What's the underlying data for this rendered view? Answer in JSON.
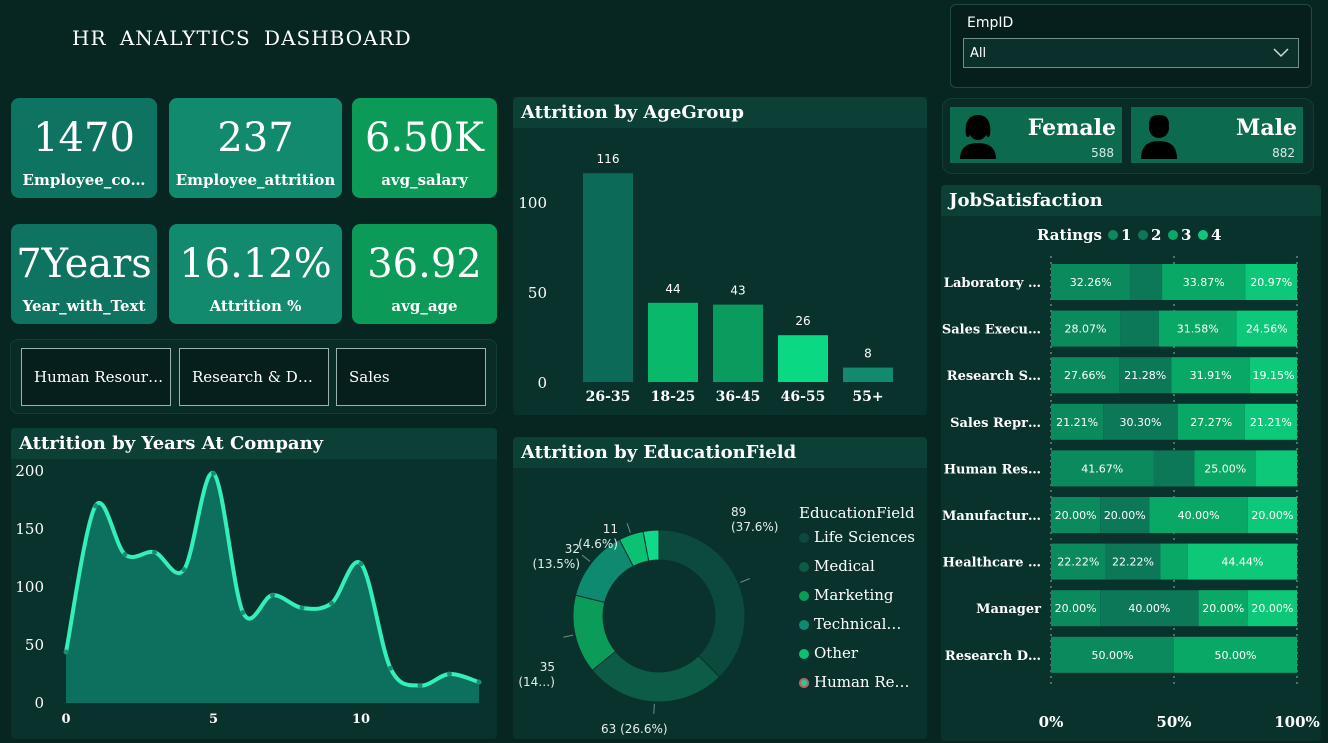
{
  "header": {
    "title": "HR  ANALYTICS  DASHBOARD"
  },
  "filter": {
    "label": "EmpID",
    "value": "All"
  },
  "kpis": [
    {
      "value": "1470",
      "label": "Employee_co…"
    },
    {
      "value": "237",
      "label": "Employee_attrition"
    },
    {
      "value": "6.50K",
      "label": "avg_salary"
    },
    {
      "value": "7Years",
      "label": "Year_with_Text"
    },
    {
      "value": "16.12%",
      "label": "Attrition %"
    },
    {
      "value": "36.92",
      "label": "avg_age"
    }
  ],
  "departments": [
    "Human Resour…",
    "Research & D…",
    "Sales"
  ],
  "gender": [
    {
      "label": "Female",
      "count": "588"
    },
    {
      "label": "Male",
      "count": "882"
    }
  ],
  "colors": {
    "bg": "#072622",
    "panel": "#0a322d",
    "kpi_dark": "#0e7360",
    "kpi_mid": "#128a6e",
    "kpi_bright": "#0c9a58",
    "line": "#32f0b8"
  },
  "age_chart": {
    "title": "Attrition by AgeGroup",
    "chart_data": {
      "type": "bar",
      "categories": [
        "26-35",
        "18-25",
        "36-45",
        "46-55",
        "55+"
      ],
      "values": [
        116,
        44,
        43,
        26,
        8
      ],
      "colors": [
        "#0c6a58",
        "#09b86a",
        "#0a9c5e",
        "#0ad882",
        "#138a6e"
      ],
      "yticks": [
        0,
        50,
        100
      ],
      "ylim": [
        0,
        130
      ]
    }
  },
  "years_chart": {
    "title": "Attrition by Years At Company",
    "chart_data": {
      "type": "area",
      "x": [
        0,
        1,
        2,
        3,
        4,
        5,
        6,
        7,
        8,
        9,
        10,
        11,
        12,
        13,
        14
      ],
      "values": [
        44,
        170,
        128,
        130,
        115,
        198,
        78,
        93,
        82,
        86,
        120,
        30,
        15,
        25,
        18
      ],
      "xticks": [
        0,
        5,
        10
      ],
      "yticks": [
        0,
        50,
        100,
        150,
        200
      ],
      "ylim": [
        0,
        210
      ]
    }
  },
  "edu_chart": {
    "title": "Attrition by EducationField",
    "legend_title": "EducationField",
    "chart_data": {
      "type": "pie",
      "categories": [
        "Life Sciences",
        "Medical",
        "Marketing",
        "Technical…",
        "Other",
        "Human Re…"
      ],
      "values": [
        89,
        63,
        35,
        32,
        11,
        7
      ],
      "colors": [
        "#0b4a3c",
        "#0d5c48",
        "#0a9c58",
        "#0e8a70",
        "#0cc174",
        "#10d98a"
      ],
      "labels": [
        {
          "l1": "89",
          "l2": "(37.6%)"
        },
        {
          "l1": "63 (26.6%)",
          "l2": ""
        },
        {
          "l1": "35",
          "l2": "(14…)"
        },
        {
          "l1": "32",
          "l2": "(13.5%)"
        },
        {
          "l1": "11",
          "l2": "(4.6%)"
        }
      ]
    }
  },
  "job_chart": {
    "title": "JobSatisfaction",
    "legend_title": "Ratings",
    "chart_data": {
      "type": "bar",
      "stacked": "100%",
      "series": [
        {
          "name": "1",
          "color": "#0b8a5e"
        },
        {
          "name": "2",
          "color": "#0c7858"
        },
        {
          "name": "3",
          "color": "#0aa866"
        },
        {
          "name": "4",
          "color": "#0dc879"
        }
      ],
      "rows": [
        {
          "label": "Laboratory …",
          "values": [
            32.26,
            12.9,
            33.87,
            20.97
          ],
          "labels": [
            "32.26%",
            "",
            "33.87%",
            "20.97%"
          ]
        },
        {
          "label": "Sales Execu…",
          "values": [
            28.07,
            15.79,
            31.58,
            24.56
          ],
          "labels": [
            "28.07%",
            "",
            "31.58%",
            "24.56%"
          ]
        },
        {
          "label": "Research S…",
          "values": [
            27.66,
            21.28,
            31.91,
            19.15
          ],
          "labels": [
            "27.66%",
            "21.28%",
            "31.91%",
            "19.15%"
          ]
        },
        {
          "label": "Sales Repr…",
          "values": [
            21.21,
            30.3,
            27.27,
            21.21
          ],
          "labels": [
            "21.21%",
            "30.30%",
            "27.27%",
            "21.21%"
          ]
        },
        {
          "label": "Human Res…",
          "values": [
            41.67,
            16.67,
            25.0,
            16.66
          ],
          "labels": [
            "41.67%",
            "",
            "25.00%",
            ""
          ]
        },
        {
          "label": "Manufactur…",
          "values": [
            20.0,
            20.0,
            40.0,
            20.0
          ],
          "labels": [
            "20.00%",
            "20.00%",
            "40.00%",
            "20.00%"
          ]
        },
        {
          "label": "Healthcare …",
          "values": [
            22.22,
            22.22,
            11.12,
            44.44
          ],
          "labels": [
            "22.22%",
            "22.22%",
            "",
            "44.44%"
          ]
        },
        {
          "label": "Manager",
          "values": [
            20.0,
            40.0,
            20.0,
            20.0
          ],
          "labels": [
            "20.00%",
            "40.00%",
            "20.00%",
            "20.00%"
          ]
        },
        {
          "label": "Research D…",
          "values": [
            50.0,
            0,
            50.0,
            0
          ],
          "labels": [
            "50.00%",
            "",
            "50.00%",
            ""
          ]
        }
      ],
      "xticks": [
        "0%",
        "50%",
        "100%"
      ]
    }
  }
}
